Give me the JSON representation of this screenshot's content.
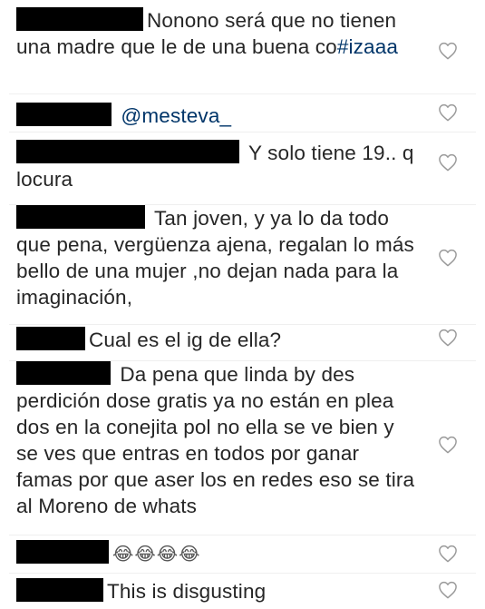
{
  "comments": [
    {
      "parts": [
        {
          "type": "redact"
        },
        {
          "type": "text",
          "value": "Nonono será que no tienen una madre que le de una buena co"
        },
        {
          "type": "mention",
          "value": "#izaaa"
        }
      ],
      "like_icon": "heart-outline-icon"
    },
    {
      "parts": [
        {
          "type": "redact"
        },
        {
          "type": "text",
          "value": " "
        },
        {
          "type": "mention",
          "value": "@mesteva_"
        }
      ],
      "like_icon": "heart-outline-icon"
    },
    {
      "parts": [
        {
          "type": "redact"
        },
        {
          "type": "text",
          "value": " Y solo tiene 19.. q locura"
        }
      ],
      "like_icon": "heart-outline-icon"
    },
    {
      "parts": [
        {
          "type": "redact"
        },
        {
          "type": "text",
          "value": " Tan joven, y ya lo da todo que pena, vergüenza ajena, regalan lo más bello de una mujer ,no dejan nada para la imaginación,"
        }
      ],
      "like_icon": "heart-outline-icon"
    },
    {
      "parts": [
        {
          "type": "redact"
        },
        {
          "type": "text",
          "value": "Cual es el ig de ella?"
        }
      ],
      "like_icon": "heart-outline-icon"
    },
    {
      "parts": [
        {
          "type": "redact"
        },
        {
          "type": "text",
          "value": " Da pena que linda by des perdición dose gratis ya no están en plea dos en la conejita pol no ella se ve bien y se ves que entras en todos por ganar famas por que aser los en redes eso se tira al Moreno de whats"
        }
      ],
      "like_icon": "heart-outline-icon"
    },
    {
      "parts": [
        {
          "type": "redact"
        },
        {
          "type": "emoji",
          "value": "😂😂😂😂"
        }
      ],
      "like_icon": "heart-outline-icon"
    },
    {
      "parts": [
        {
          "type": "redact"
        },
        {
          "type": "text",
          "value": "This is disgusting"
        }
      ],
      "like_icon": "heart-outline-icon"
    }
  ]
}
